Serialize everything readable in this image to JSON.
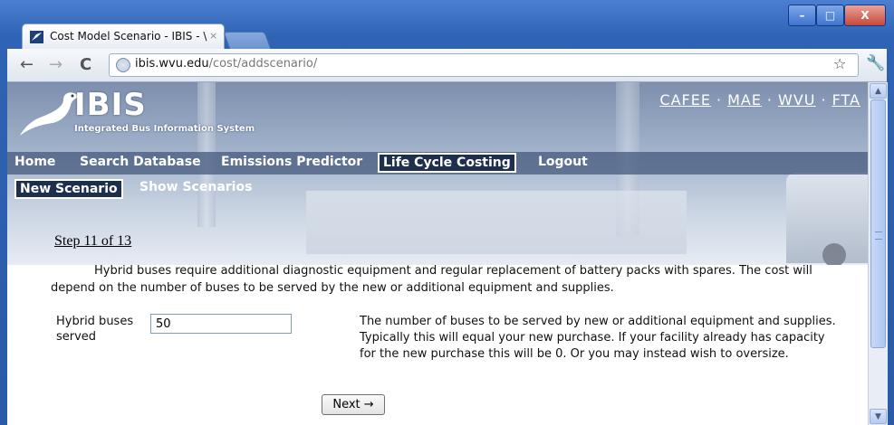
{
  "browser": {
    "tab_title": "Cost Model Scenario - IBIS - \\",
    "tab_close": "×",
    "url_host": "ibis.wvu.edu",
    "url_path": "/cost/addscenario/",
    "window_buttons": [
      "–",
      "□",
      "X"
    ]
  },
  "site": {
    "logo_text": "IBIS",
    "logo_tagline": "Integrated Bus Information System",
    "top_links": [
      "CAFEE",
      "MAE",
      "WVU",
      "FTA"
    ],
    "top_link_separator": "·"
  },
  "main_nav": [
    "Home",
    "Search Database",
    "Emissions Predictor",
    "Life Cycle Costing",
    "Logout"
  ],
  "main_nav_active": "Life Cycle Costing",
  "sub_nav": [
    "New Scenario",
    "Show Scenarios"
  ],
  "sub_nav_active": "New Scenario",
  "form": {
    "step": "Step 11 of 13",
    "intro": "Hybrid buses require additional diagnostic equipment and regular replacement of battery packs with spares. The cost will depend on the number of buses to be served by the new or additional equipment and supplies.",
    "field_label": "Hybrid buses served",
    "field_value": "50",
    "help_text": "The number of buses to be served by new or additional equipment and supplies. Typically this will equal your new purchase. If your facility already has capacity for the new purchase this will be 0. Or you may instead wish to oversize.",
    "next_label": "Next →"
  },
  "icons": {
    "back": "back-arrow-icon",
    "forward": "forward-arrow-icon",
    "reload": "reload-icon",
    "star": "bookmark-star-icon",
    "wrench": "wrench-icon"
  }
}
